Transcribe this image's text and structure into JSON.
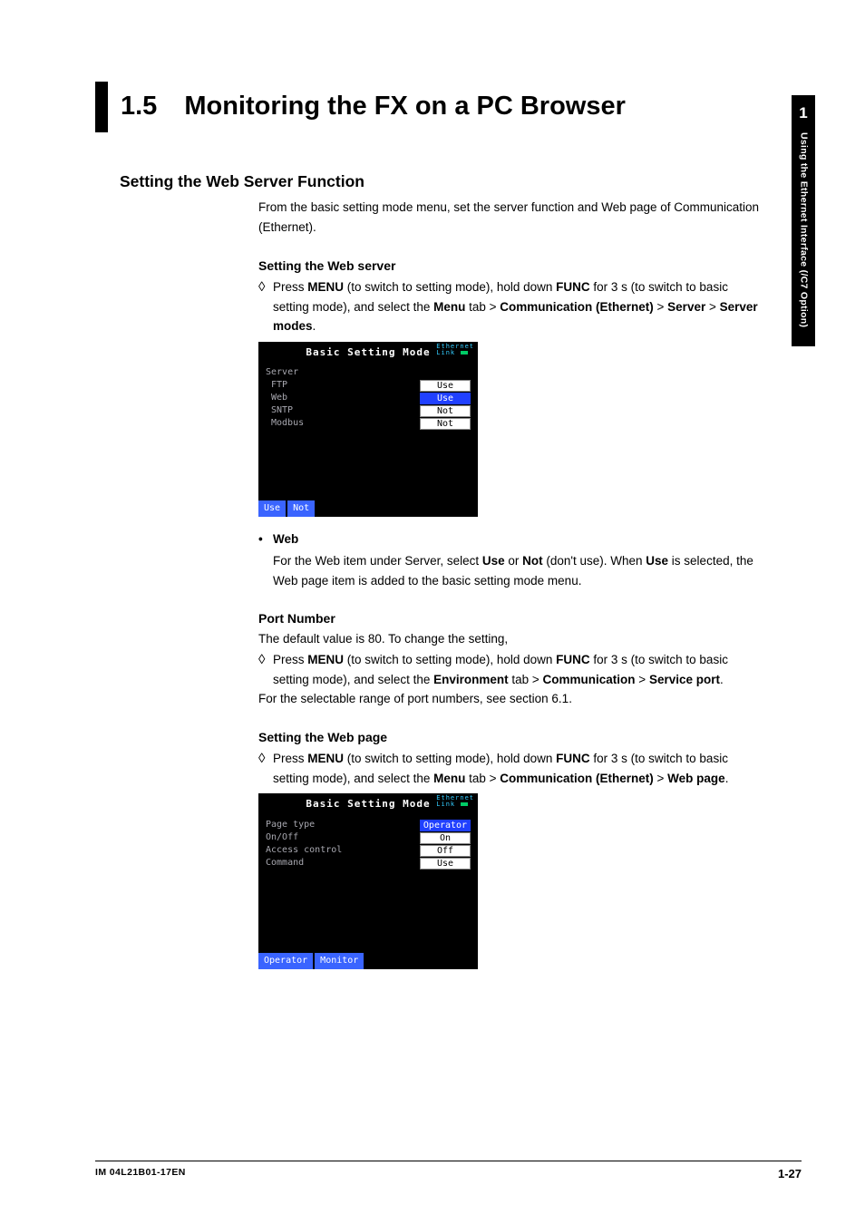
{
  "sidebar": {
    "chapter": "1",
    "label": "Using the Ethernet Interface (/C7 Option)"
  },
  "heading": {
    "num": "1.5",
    "title": "Monitoring the FX on a PC Browser"
  },
  "s1": {
    "title": "Setting the Web Server Function",
    "intro": "From the basic setting mode menu, set the server function and Web page of Communication (Ethernet)."
  },
  "ws": {
    "title": "Setting the Web server",
    "step_a": "Press ",
    "step_menu": "MENU",
    "step_b": " (to switch to setting mode), hold down ",
    "step_func": "FUNC",
    "step_c": " for 3 s (to switch to basic setting mode), and select the ",
    "step_menutab": "Menu",
    "step_d": " tab > ",
    "step_comm": "Communication (Ethernet)",
    "step_e": " > ",
    "step_srv": "Server",
    "step_f": " > ",
    "step_modes": "Server modes",
    "step_g": "."
  },
  "shot1": {
    "header": "Basic Setting Mode",
    "eth1": "Ethernet",
    "eth2": "Link",
    "grp": "Server",
    "rows": [
      {
        "label": "FTP",
        "val": "Use",
        "sel": false
      },
      {
        "label": "Web",
        "val": "Use",
        "sel": true
      },
      {
        "label": "SNTP",
        "val": "Not",
        "sel": false
      },
      {
        "label": "Modbus",
        "val": "Not",
        "sel": false
      }
    ],
    "btns": [
      "Use",
      "Not"
    ]
  },
  "web": {
    "bullet": "•",
    "title": "Web",
    "a": "For the Web item under Server, select ",
    "use": "Use",
    "b": " or ",
    "not": "Not",
    "c": " (don't use). When ",
    "use2": "Use",
    "d": " is selected, the Web page item is added to the basic setting mode menu."
  },
  "pn": {
    "title": "Port Number",
    "intro": "The default value is 80. To change the setting,",
    "step_a": "Press ",
    "menu": "MENU",
    "step_b": " (to switch to setting mode), hold down ",
    "func": "FUNC",
    "step_c": " for 3 s (to switch to basic setting mode), and select the ",
    "env": "Environment",
    "step_d": " tab > ",
    "comm": "Communication",
    "step_e": " > ",
    "sp": "Service port",
    "step_f": ".",
    "after": "For the selectable range of port numbers, see section 6.1."
  },
  "wp": {
    "title": "Setting the Web page",
    "step_a": "Press ",
    "menu": "MENU",
    "step_b": " (to switch to setting mode), hold down ",
    "func": "FUNC",
    "step_c": " for 3 s (to switch to basic setting mode), and select the ",
    "mtab": "Menu",
    "step_d": " tab > ",
    "comm": "Communication (Ethernet)",
    "step_e": " > ",
    "webpage": "Web page",
    "step_f": "."
  },
  "shot2": {
    "header": "Basic Setting Mode",
    "eth1": "Ethernet",
    "eth2": "Link",
    "rows": [
      {
        "label": "Page type",
        "val": "Operator",
        "sel": true
      },
      {
        "label": "On/Off",
        "val": "On",
        "sel": false
      },
      {
        "label": "Access control",
        "val": "Off",
        "sel": false
      },
      {
        "label": "Command",
        "val": "Use",
        "sel": false
      }
    ],
    "btns": [
      "Operator",
      "Monitor"
    ]
  },
  "footer": {
    "code": "IM 04L21B01-17EN",
    "page": "1-27"
  }
}
